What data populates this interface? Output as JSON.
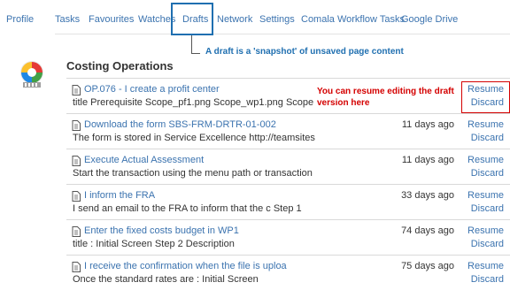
{
  "nav": {
    "items": [
      {
        "label": "Profile"
      },
      {
        "label": "Tasks"
      },
      {
        "label": "Favourites"
      },
      {
        "label": "Watches"
      },
      {
        "label": "Drafts"
      },
      {
        "label": "Network"
      },
      {
        "label": "Settings"
      },
      {
        "label": "Comala Workflow Tasks"
      },
      {
        "label": "Google Drive"
      }
    ],
    "active": "Drafts"
  },
  "annotations": {
    "drafts_callout": "A draft is a 'snapshot'  of unsaved page content",
    "resume_callout": "You can resume editing the draft version here"
  },
  "section": {
    "title": "Costing Operations"
  },
  "drafts": [
    {
      "title": "OP.076 - I create a profit center",
      "desc": "title Prerequisite Scope_pf1.png  Scope_wp1.png Scope",
      "age": "",
      "resume": "Resume",
      "discard": "Discard"
    },
    {
      "title": "Download the form SBS-FRM-DRTR-01-002",
      "desc": "The form is stored in Service Excellence http://teamsites",
      "age": "11 days ago",
      "resume": "Resume",
      "discard": "Discard"
    },
    {
      "title": "Execute Actual Assessment",
      "desc": "Start the transaction using the menu path or transaction",
      "age": "11 days ago",
      "resume": "Resume",
      "discard": "Discard"
    },
    {
      "title": "I inform the FRA",
      "desc": "I send an email to the FRA to inform that the c Step 1",
      "age": "33 days ago",
      "resume": "Resume",
      "discard": "Discard"
    },
    {
      "title": "Enter the fixed costs budget in WP1",
      "desc": "title   : Initial Screen        Step 2 Description",
      "age": "74 days ago",
      "resume": "Resume",
      "discard": "Discard"
    },
    {
      "title": " I receive the confirmation when the file is uploa",
      "desc": "Once the standard rates are : Initial Screen",
      "age": "75 days ago",
      "resume": "Resume",
      "discard": "Discard"
    }
  ],
  "colors": {
    "link": "#3b73af",
    "highlight_blue": "#1f6fb0",
    "highlight_red": "#d40000"
  }
}
